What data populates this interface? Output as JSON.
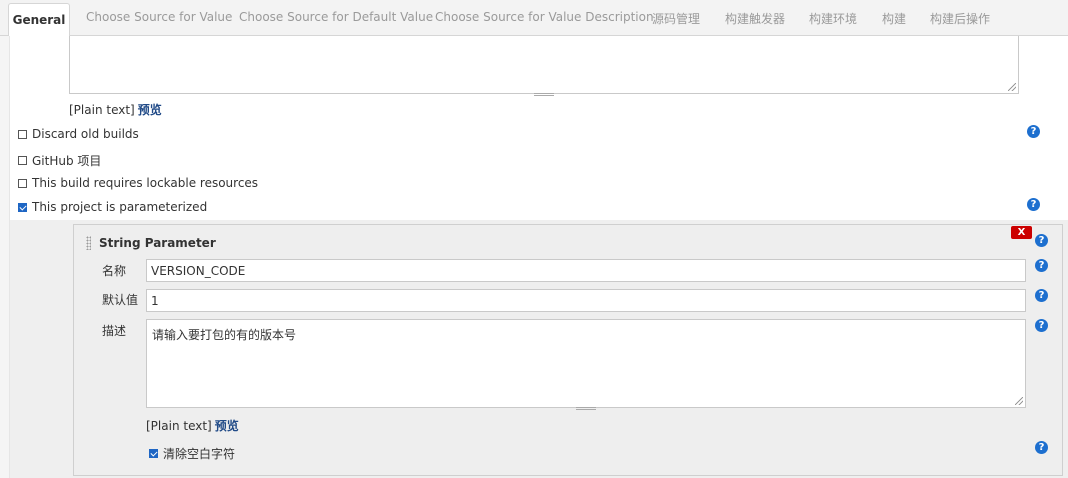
{
  "tabs": [
    {
      "label": "General",
      "active": true
    },
    {
      "label": "Choose Source for Value"
    },
    {
      "label": "Choose Source for Default Value"
    },
    {
      "label": "Choose Source for Value Description"
    },
    {
      "label": "源码管理"
    },
    {
      "label": "构建触发器"
    },
    {
      "label": "构建环境"
    },
    {
      "label": "构建"
    },
    {
      "label": "构建后操作"
    }
  ],
  "description_editor": {
    "plain_label": "[Plain text]",
    "preview_link": "预览"
  },
  "options": [
    {
      "label": "Discard old builds",
      "checked": false
    },
    {
      "label": "GitHub 项目",
      "checked": false
    },
    {
      "label": "This build requires lockable resources",
      "checked": false
    },
    {
      "label": "This project is parameterized",
      "checked": true
    }
  ],
  "parameter": {
    "title": "String Parameter",
    "delete_label": "X",
    "name_label": "名称",
    "name_value": "VERSION_CODE",
    "default_label": "默认值",
    "default_value": "1",
    "desc_label": "描述",
    "desc_value": "请输入要打包的有的版本号",
    "plain_label": "[Plain text]",
    "preview_link": "预览",
    "trim_label": "清除空白字符",
    "trim_checked": true
  },
  "help_glyph": "?",
  "colors": {
    "link": "#204a87",
    "help": "#1d6fcf",
    "delete": "#cc0000",
    "checkbox_checked": "#1e66c4"
  }
}
